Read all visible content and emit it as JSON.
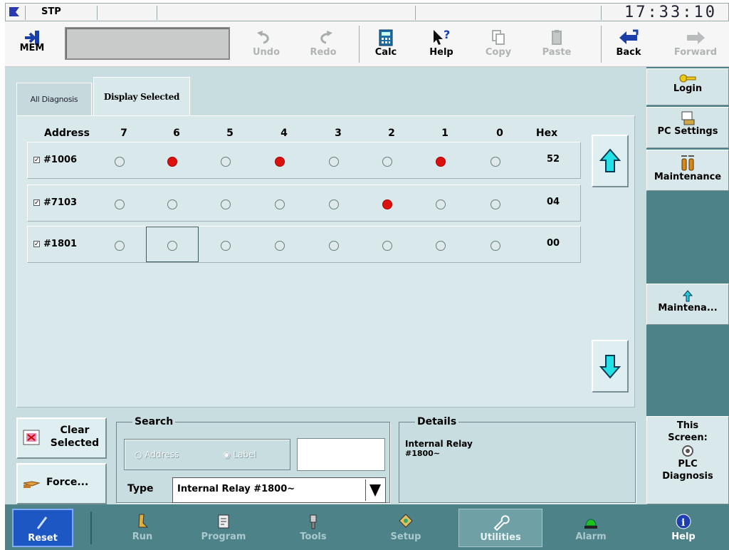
{
  "status": {
    "mode": "STP",
    "clock": "17:33:10"
  },
  "toolbar": {
    "mem_label": "MEM",
    "undo": "Undo",
    "redo": "Redo",
    "calc": "Calc",
    "help": "Help",
    "copy": "Copy",
    "paste": "Paste",
    "back": "Back",
    "forward": "Forward"
  },
  "tabs": {
    "all_diagnosis": "All Diagnosis",
    "display_selected": "Display Selected"
  },
  "grid": {
    "headers": {
      "address": "Address",
      "b7": "7",
      "b6": "6",
      "b5": "5",
      "b4": "4",
      "b3": "3",
      "b2": "2",
      "b1": "1",
      "b0": "0",
      "hex": "Hex"
    },
    "rows": [
      {
        "checked": true,
        "address": "#1006",
        "bits": [
          0,
          1,
          0,
          1,
          0,
          0,
          1,
          0
        ],
        "hex": "52"
      },
      {
        "checked": true,
        "address": "#7103",
        "bits": [
          0,
          0,
          0,
          0,
          0,
          1,
          0,
          0
        ],
        "hex": "04"
      },
      {
        "checked": true,
        "address": "#1801",
        "bits": [
          0,
          0,
          0,
          0,
          0,
          0,
          0,
          0
        ],
        "hex": "00"
      }
    ],
    "selected_cell": {
      "row": 2,
      "bit": "6"
    }
  },
  "actions": {
    "clear_selected_l1": "Clear",
    "clear_selected_l2": "Selected",
    "force": "Force..."
  },
  "search": {
    "legend": "Search",
    "radio_address": "Address",
    "radio_label": "Label",
    "selected_radio": "Label",
    "input_value": "",
    "type_label": "Type",
    "type_value": "Internal Relay #1800~"
  },
  "details": {
    "legend": "Details",
    "line1": "Internal Relay",
    "line2": "#1800~"
  },
  "sidebar": {
    "login": "Login",
    "pc_settings": "PC Settings",
    "maintenance": "Maintenance",
    "maintena_btn": "Maintena...",
    "this_screen_l1": "This",
    "this_screen_l2": "Screen:",
    "this_screen_l3": "PLC",
    "this_screen_l4": "Diagnosis"
  },
  "nav": {
    "reset": "Reset",
    "run": "Run",
    "program": "Program",
    "tools": "Tools",
    "setup": "Setup",
    "utilities": "Utilities",
    "alarm": "Alarm",
    "help": "Help",
    "active": "Utilities"
  },
  "colors": {
    "bit_on": "#dd1010",
    "panel_bg": "#c8dde0",
    "nav_bg": "#4e8289",
    "reset_bg": "#1d57c4"
  }
}
